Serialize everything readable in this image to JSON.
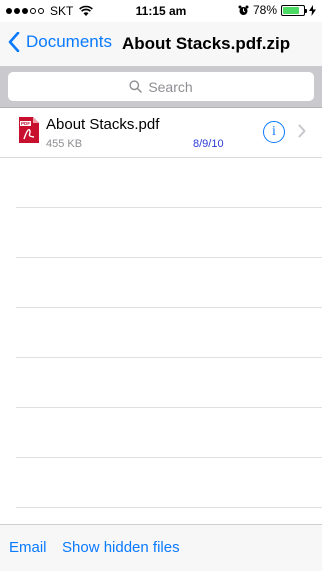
{
  "status_bar": {
    "carrier": "SKT",
    "time": "11:15 am",
    "battery_percent": "78%",
    "battery_level": 0.78,
    "signal_bars_filled": 3,
    "signal_bars_total": 5
  },
  "nav": {
    "back_label": "Documents",
    "title": "About Stacks.pdf.zip"
  },
  "search": {
    "placeholder": "Search"
  },
  "files": [
    {
      "name": "About Stacks.pdf",
      "size": "455 KB",
      "date": "8/9/10",
      "icon": "pdf-file-icon",
      "info_glyph": "i"
    }
  ],
  "empty_rows": 7,
  "toolbar": {
    "email_label": "Email",
    "show_hidden_label": "Show hidden files"
  },
  "colors": {
    "accent": "#0a7aff",
    "date": "#2a3cd6",
    "battery": "#4cd964",
    "pdf_red": "#c8102e"
  }
}
